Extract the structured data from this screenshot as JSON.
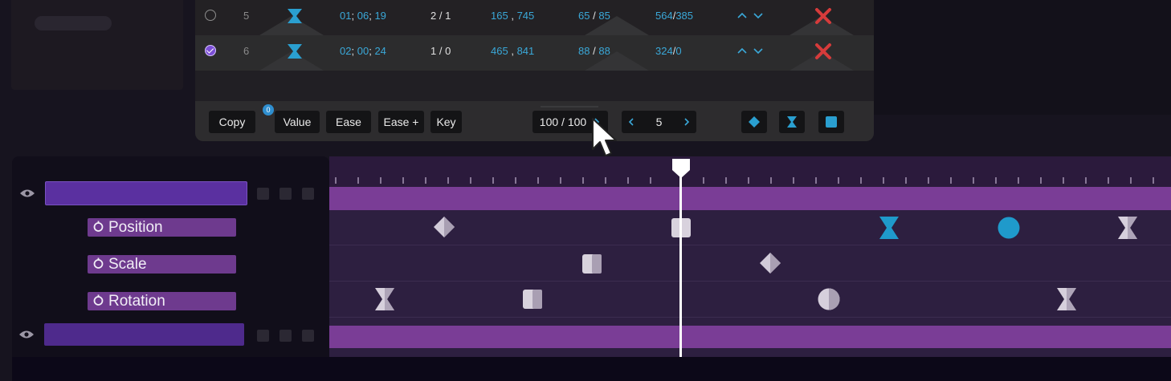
{
  "rows": [
    {
      "index": "5",
      "time": [
        "01",
        "06",
        "19"
      ],
      "frame": "2 / 1",
      "pos": [
        "165",
        "745"
      ],
      "scale": [
        "65",
        "85"
      ],
      "size_a": "564",
      "size_b": "385",
      "checked": false
    },
    {
      "index": "6",
      "time": [
        "02",
        "00",
        "24"
      ],
      "frame": "1 / 0",
      "pos": [
        "465",
        "841"
      ],
      "scale": [
        "88",
        "88"
      ],
      "size_a": "324",
      "size_b": "0",
      "checked": true
    }
  ],
  "separators": {
    "time": ";",
    "pos": ",",
    "scale": "/",
    "size": "/"
  },
  "toolbar": {
    "copy_label": "Copy",
    "copy_badge": "0",
    "value_label": "Value",
    "ease_label": "Ease",
    "ease_plus_label": "Ease +",
    "key_label": "Key",
    "page_counter": "100 / 100",
    "nav_value": "5"
  },
  "tracks": {
    "properties": [
      "Position",
      "Scale",
      "Rotation"
    ]
  },
  "icons": {
    "visible": "eye-icon",
    "stopwatch": "stopwatch-icon",
    "delete": "close-icon",
    "keyframe_hourglass": "hourglass-icon",
    "keyframe_diamond": "diamond-icon",
    "keyframe_square": "square-icon",
    "keyframe_circle": "circle-icon"
  },
  "colors": {
    "accent_blue": "#3aa8d8",
    "delete_red": "#d63b3b",
    "track_purple": "#7a3d96",
    "property_purple": "#6e3a8e",
    "layer_bar": "#5a30a0"
  }
}
